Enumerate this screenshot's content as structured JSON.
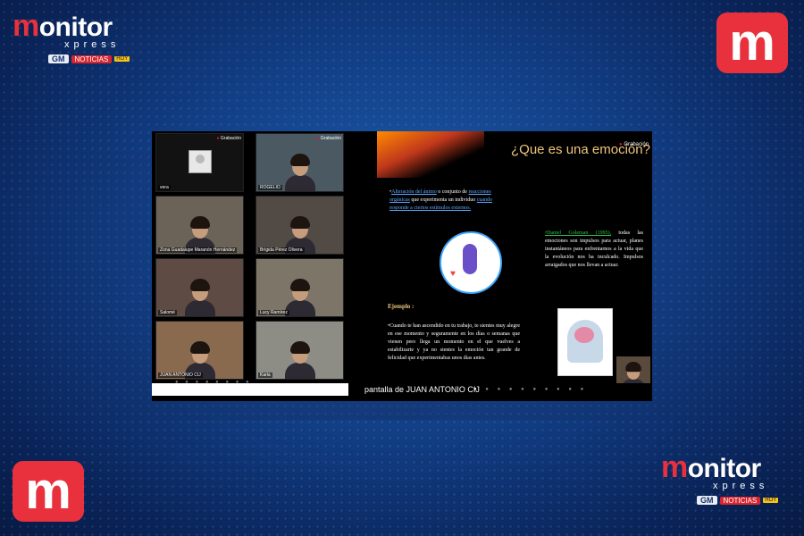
{
  "brand": {
    "top_left": {
      "logo_m": "m",
      "logo_rest": "onitor",
      "logo_sub": "xpress",
      "gm": "GM",
      "noticias": "NOTICIAS",
      "hoy": "HOY"
    },
    "bottom_right": {
      "logo_m": "m",
      "logo_rest": "onitor",
      "logo_sub": "xpress",
      "gm": "GM",
      "noticias": "NOTICIAS",
      "hoy": "HOY"
    },
    "badge_letter": "m",
    "accent_color": "#e8313c"
  },
  "meeting": {
    "recording_label": "Grabación",
    "participants": [
      {
        "name": "vera",
        "camera": "avatar"
      },
      {
        "name": "ROGELIO",
        "camera": "video"
      },
      {
        "name": "Zona Guadalupe Maranón Hernández",
        "camera": "video"
      },
      {
        "name": "Brígida Pérez Olivera",
        "camera": "video"
      },
      {
        "name": "Salomé",
        "camera": "video"
      },
      {
        "name": "Lucy Ramírez",
        "camera": "video"
      },
      {
        "name": "JUAN ANTONIO CIJ",
        "camera": "video"
      },
      {
        "name": "Karla",
        "camera": "video"
      }
    ],
    "screen_share_label": "pantalla de JUAN ANTONIO CIJ"
  },
  "slide": {
    "title": "¿Que es una emoción?",
    "recording_label": "Grabación",
    "definition_parts": [
      "•",
      "Alteración del ánimo",
      " o conjunto de ",
      "reacciones orgánicas",
      " que experimenta un individuo ",
      "cuando",
      " responde a ciertos estímulos externos."
    ],
    "example_label": "Ejemplo :",
    "example_text": "•Cuando te han ascendido en tu trabajo, te sientes muy alegre en ese momento y seguramente en los días o semanas que vienen pero llega un momento en el que vuelves a estabilizarte y ya no sientes la emoción tan grande de felicidad que experimentabas unos días antes.",
    "goleman_ref": "•Daniel Goleman (1995),",
    "goleman_text": " todas las emociones son impulsos para actuar, planes instantáneos para enfrentarnos a la vida que la evolución nos ha inculcado. Impulsos arraigados que nos llevan a actuar."
  }
}
